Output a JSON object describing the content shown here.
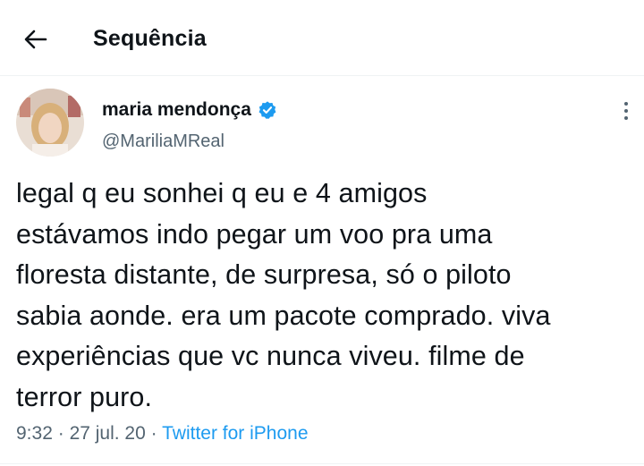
{
  "header": {
    "title": "Sequência",
    "back_icon": "arrow-left-icon"
  },
  "tweet": {
    "author": {
      "name": "maria mendonça",
      "handle": "@MariliaMReal",
      "verified": true,
      "verified_icon": "verified-badge-icon",
      "verified_color": "#1d9bf0"
    },
    "more_icon": "more-vertical-icon",
    "text": "legal q eu sonhei q eu e 4 amigos\nestávamos indo pegar um voo pra uma\nfloresta distante, de surpresa, só o piloto\nsabia aonde. era um pacote comprado. viva\nexperiências que vc nunca viveu. filme de\nterror puro.",
    "time": "9:32",
    "separator": "·",
    "date": "27 jul. 20",
    "source": "Twitter for iPhone"
  },
  "colors": {
    "text": "#0f1419",
    "secondary": "#536471",
    "accent": "#1d9bf0",
    "border": "#eff3f4"
  }
}
